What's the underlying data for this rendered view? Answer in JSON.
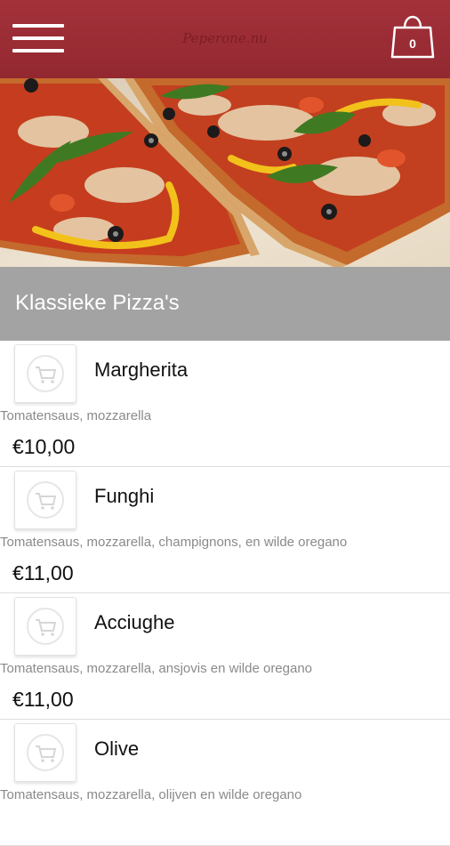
{
  "header": {
    "brand": "Peperone.nu",
    "cart_count": "0"
  },
  "category": {
    "title": "Klassieke Pizza's"
  },
  "items": [
    {
      "name": "Margherita",
      "description": "Tomatensaus, mozzarella",
      "price": "€10,00"
    },
    {
      "name": "Funghi",
      "description": "Tomatensaus, mozzarella, champignons, en wilde oregano",
      "price": "€11,00"
    },
    {
      "name": "Acciughe",
      "description": "Tomatensaus, mozzarella, ansjovis en wilde oregano",
      "price": "€11,00"
    },
    {
      "name": "Olive",
      "description": "Tomatensaus, mozzarella, olijven en wilde oregano",
      "price": ""
    }
  ],
  "icons": {
    "menu": "hamburger-icon",
    "cart": "shopping-bag-icon",
    "item_thumb": "shopping-cart-icon"
  },
  "colors": {
    "header": "#9e2d35",
    "category_bar": "#a3a3a3"
  }
}
